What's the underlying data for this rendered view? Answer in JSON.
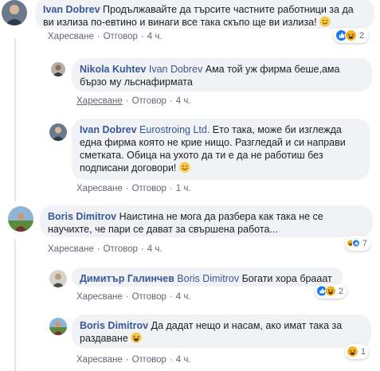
{
  "actions": {
    "like": "Харесване",
    "reply": "Отговор",
    "separator": "·"
  },
  "comments": [
    {
      "author": "Ivan Dobrev",
      "text": "Продължавайте да търсите частните работници за да ви излиза по-евтино и винаги все така скъпо ще ви излиза!",
      "emoji": "smiling-face",
      "time": "4 ч.",
      "reaction_count": "2",
      "reactions": [
        "like",
        "haha"
      ]
    },
    {
      "author": "Nikola Kuhtev",
      "mention": "Ivan Dobrev",
      "text": "Ама той уж фирма беше,ама бързо му льснафирмата",
      "time": "4 ч."
    },
    {
      "author": "Ivan Dobrev",
      "mention": "Eurostroing Ltd.",
      "text": "Ето така, може би изглежда една фирма която не крие нищо. Разгледай и си направи сметката. Обица на ухото да ти е да не работиш без подписани договори!",
      "emoji": "smiling-face",
      "time": "1 ч."
    },
    {
      "author": "Boris Dimitrov",
      "text": "Наистина не мога да разбера как така не се научихте, че пари се дават за свършена работа...",
      "time": "4 ч.",
      "reaction_count": "7",
      "reactions": [
        "haha",
        "like"
      ]
    },
    {
      "author": "Димитър Галинчев",
      "mention": "Boris Dimitrov",
      "text": "Богати хора брааат",
      "time": "4 ч.",
      "reaction_count": "2",
      "reactions": [
        "like",
        "haha"
      ]
    },
    {
      "author": "Boris Dimitrov",
      "text": "Да дадат нещо и насам, ако имат така за раздаване",
      "emoji": "laughing-face",
      "time": "4 ч.",
      "reaction_count": "1",
      "reactions": [
        "haha"
      ]
    }
  ],
  "colors": {
    "name": "#385898",
    "bubble": "#f0f2f5",
    "like": "#1877f2",
    "haha": "#f7b125"
  }
}
